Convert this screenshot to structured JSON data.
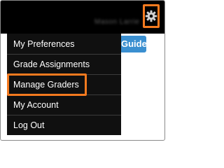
{
  "header": {
    "username": "Mason Larrie",
    "settings_icon": "gear-icon"
  },
  "guide_button": {
    "label": "Guide"
  },
  "user_menu": {
    "items": [
      {
        "label": "My Preferences"
      },
      {
        "label": "Grade Assignments"
      },
      {
        "label": "Manage Graders"
      },
      {
        "label": "My Account"
      },
      {
        "label": "Log Out"
      }
    ]
  },
  "colors": {
    "topbar": "#000000",
    "menu_background": "#101010",
    "highlight": "#f47a1f",
    "guide_button": "#3a8fd0"
  }
}
